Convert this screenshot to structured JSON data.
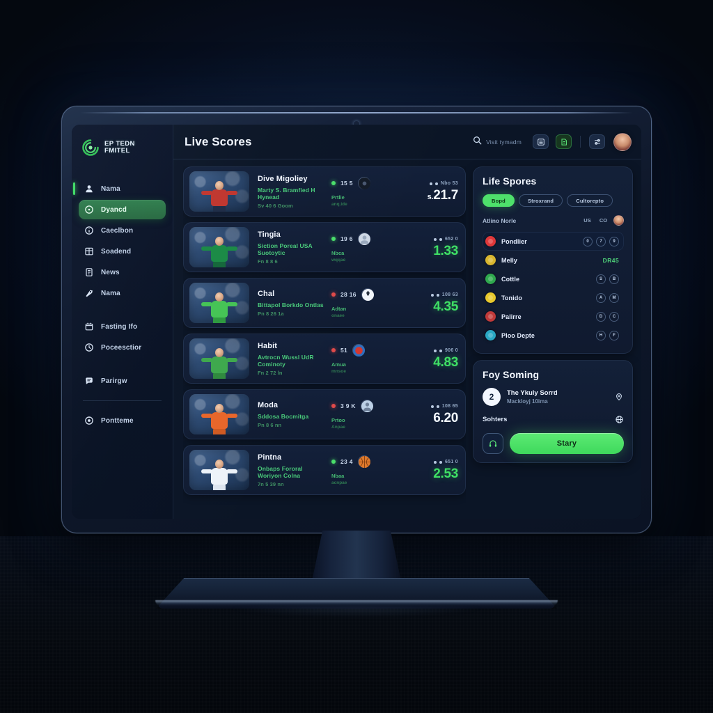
{
  "brand": {
    "line1": "EP TEDN",
    "line2": "FMITEL",
    "logo_icon": "spiral-logo-icon",
    "accent": "#3ddb62"
  },
  "sidebar": {
    "items": [
      {
        "label": "Nama",
        "icon": "user-icon",
        "state": "accent"
      },
      {
        "label": "Dyancd",
        "icon": "target-icon",
        "state": "active"
      },
      {
        "label": "Caeclbon",
        "icon": "info-icon",
        "state": "normal"
      },
      {
        "label": "Soadend",
        "icon": "grid-icon",
        "state": "normal"
      },
      {
        "label": "News",
        "icon": "document-icon",
        "state": "normal"
      },
      {
        "label": "Nama",
        "icon": "rocket-icon",
        "state": "normal"
      },
      {
        "label": "Fasting Ifo",
        "icon": "calendar-icon",
        "state": "normal"
      },
      {
        "label": "Poceesctior",
        "icon": "clock-icon",
        "state": "normal"
      },
      {
        "label": "Parirgw",
        "icon": "chat-icon",
        "state": "normal"
      },
      {
        "label": "Pontteme",
        "icon": "settings-icon",
        "state": "normal"
      }
    ]
  },
  "topbar": {
    "title": "Live Scores",
    "search": {
      "icon": "search-icon",
      "placeholder": "Visit tymadm"
    },
    "buttons": [
      {
        "icon": "list-icon",
        "variant": "plain"
      },
      {
        "icon": "export-icon",
        "variant": "green"
      },
      {
        "icon": "filter-icon",
        "variant": "plain"
      }
    ],
    "avatar": "user-avatar"
  },
  "matches": [
    {
      "title": "Dive Migoliey",
      "subtitle": "Marty S. Bramfied H Hynead",
      "meta": "Sv 40 6 Goom",
      "count": "15 5",
      "count_dot": "live",
      "mid_label": "Prtlie",
      "mid_sub": "anq.ide",
      "right_tiny": "Nbo 53",
      "odds": "21.7",
      "odds_prefix": "s.",
      "odds_color": "white",
      "badge": "dark-badge",
      "kit": "#c0362e",
      "legs": "#1e2b46",
      "shorts": "#d04436"
    },
    {
      "title": "Tingia",
      "subtitle": "Siction Poreal USA Suotoytic",
      "meta": "Fn 8 8 6",
      "count": "19 6",
      "count_dot": "live",
      "mid_label": "Nbca",
      "mid_sub": "wqqae",
      "right_tiny": "652 0",
      "odds": "1.33",
      "odds_prefix": "",
      "odds_color": "green",
      "badge": "photo-badge",
      "kit": "#1a8a45",
      "legs": "#14673a",
      "shorts": "#1a8a45"
    },
    {
      "title": "Chal",
      "subtitle": "Bittapol Borkdo Ontlas",
      "meta": "Pn 8 26 1a",
      "count": "28 16",
      "count_dot": "red",
      "mid_label": "Adtan",
      "mid_sub": "onaee",
      "right_tiny": "108 63",
      "odds": "4.35",
      "odds_prefix": "",
      "odds_color": "green",
      "badge": "ball-badge",
      "kit": "#45c455",
      "legs": "#2e9a3f",
      "shorts": "#45c455"
    },
    {
      "title": "Habit",
      "subtitle": "Avtrocn Wussl UdR Cominoty",
      "meta": "Fn 2 72 ln",
      "count": "51",
      "count_dot": "red",
      "mid_label": "Amua",
      "mid_sub": "mnsoe",
      "right_tiny": "906 0",
      "odds": "4.83",
      "odds_prefix": "",
      "odds_color": "green",
      "badge": "cricket-badge",
      "kit": "#3ea84d",
      "legs": "#2f8a3e",
      "shorts": "#3ea84d"
    },
    {
      "title": "Moda",
      "subtitle": "Sddosa Bocmitga",
      "meta": "Pn 8 6 nn",
      "count": "3 9 K",
      "count_dot": "red",
      "mid_label": "Prtoo",
      "mid_sub": "Anpae",
      "right_tiny": "108 65",
      "odds": "6.20",
      "odds_prefix": "",
      "odds_color": "white",
      "badge": "player-badge",
      "kit": "#e8662a",
      "legs": "#cf5a22",
      "shorts": "#e8662a"
    },
    {
      "title": "Pintna",
      "subtitle": "Onbaps Fororal Woriyon Colna",
      "meta": "7n 5 39 nn",
      "count": "23 4",
      "count_dot": "live",
      "mid_label": "Nbaa",
      "mid_sub": "acnpae",
      "right_tiny": "651 0",
      "odds": "2.53",
      "odds_prefix": "",
      "odds_color": "green",
      "badge": "basketball-badge",
      "kit": "#eef3f9",
      "legs": "#dde5ef",
      "shorts": "#eef3f9"
    }
  ],
  "rail": {
    "leaderboard": {
      "title": "Life Spores",
      "chips": [
        {
          "label": "Bopd",
          "active": true
        },
        {
          "label": "Stroxrand",
          "active": false
        },
        {
          "label": "Cultorepto",
          "active": false
        }
      ],
      "head": {
        "label": "Atlino Norle",
        "val1": "US",
        "val2": "CO",
        "avatar": "user-avatar"
      },
      "rows": [
        {
          "name": "Pondlier",
          "color": "#e0383a",
          "type": "actions",
          "actions": [
            "0",
            "7",
            "9"
          ],
          "highlight": true
        },
        {
          "name": "Melly",
          "color": "#d8b52e",
          "type": "score",
          "score": "DR45",
          "highlight": false
        },
        {
          "name": "Cottle",
          "color": "#2fa84e",
          "type": "actions",
          "actions": [
            "S",
            "B"
          ],
          "highlight": false
        },
        {
          "name": "Tonido",
          "color": "#e8c82c",
          "type": "actions",
          "actions": [
            "A",
            "M"
          ],
          "highlight": false
        },
        {
          "name": "Palirre",
          "color": "#c03a3a",
          "type": "actions",
          "actions": [
            "D",
            "C"
          ],
          "highlight": false
        },
        {
          "name": "Ploo Depte",
          "color": "#2aa8c4",
          "type": "actions",
          "actions": [
            "H",
            "F"
          ],
          "highlight": false
        }
      ]
    },
    "session": {
      "title": "Foy Soming",
      "number": "2",
      "item_title": "The Ykuly Sorrd",
      "item_sub": "Mackloyj 10ima",
      "item_icon": "location-pin-icon",
      "option_label": "Sohters",
      "option_icon": "globe-icon",
      "cta_icon": "headset-icon",
      "cta_label": "Stary"
    }
  },
  "colors": {
    "accent_green": "#4ee06b",
    "panel_bg": "#132038",
    "screen_bg": "#0b1526",
    "sidebar_bg": "#0a1328"
  }
}
